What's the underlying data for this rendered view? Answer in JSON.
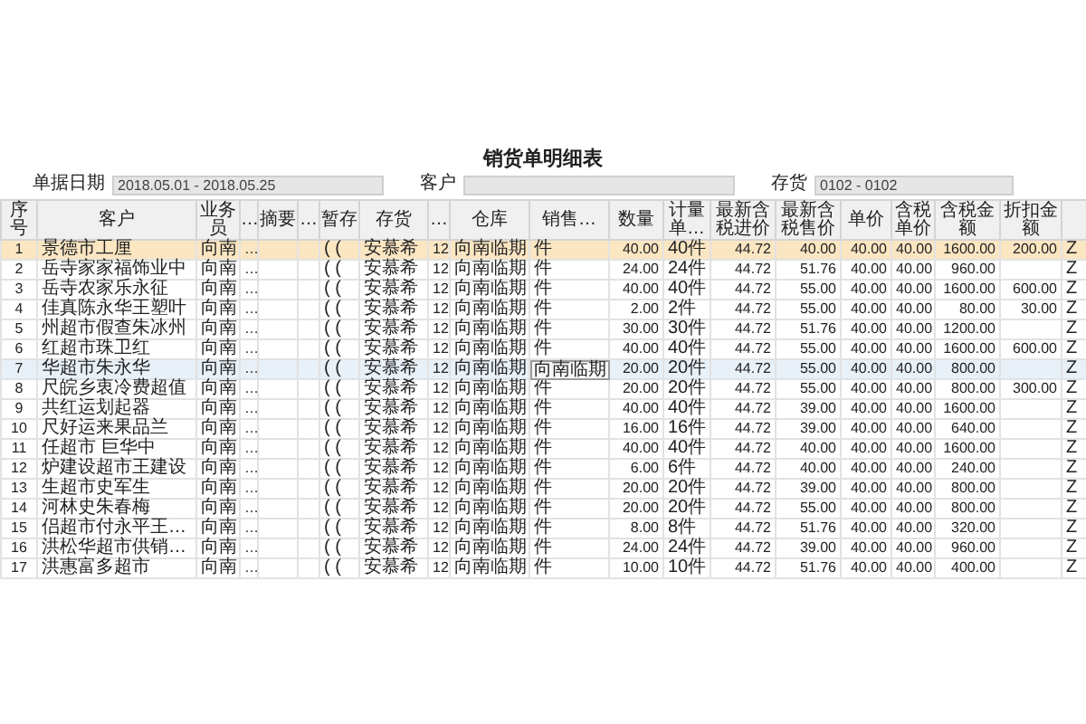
{
  "title": "销货单明细表",
  "filters": [
    {
      "label": "单据日期",
      "value": "2018.05.01 - 2018.05.25"
    },
    {
      "label": "客户"
    },
    {
      "label": "存货",
      "value": "0102 - 0102"
    }
  ],
  "table": {
    "columns": [
      "序号",
      "客户",
      "业务员",
      "…",
      "摘要",
      "…",
      "暂存",
      "存货",
      "…",
      "仓库",
      "销售…",
      "数量",
      "计量单…",
      "最新含税进价",
      "最新含税售价",
      "单价",
      "含税单价",
      "含税金额",
      "折扣金额"
    ],
    "rows": [
      {
        "selected": true,
        "hovered": false,
        "cells": [
          "1",
          "景德市工厘",
          "向南",
          "…",
          null,
          null,
          "( (",
          "安慕希",
          "12",
          "向南临期",
          "件",
          "40.00",
          "40件",
          "44.72",
          "40.00",
          "40.00",
          "40.00",
          "1600.00",
          "200.00",
          "Z"
        ]
      },
      {
        "selected": false,
        "hovered": false,
        "cells": [
          "2",
          "岳寺家家福饰业中",
          "向南",
          "…",
          null,
          null,
          "( (",
          "安慕希",
          "12",
          "向南临期",
          "件",
          "24.00",
          "24件",
          "44.72",
          "51.76",
          "40.00",
          "40.00",
          "960.00",
          null,
          "Z"
        ]
      },
      {
        "selected": false,
        "hovered": false,
        "cells": [
          "3",
          "岳寺农家乐永征",
          "向南",
          "…",
          null,
          null,
          "( (",
          "安慕希",
          "12",
          "向南临期",
          "件",
          "40.00",
          "40件",
          "44.72",
          "55.00",
          "40.00",
          "40.00",
          "1600.00",
          "600.00",
          "Z"
        ]
      },
      {
        "selected": false,
        "hovered": false,
        "cells": [
          "4",
          "佳真陈永华王塑叶",
          "向南",
          "…",
          null,
          null,
          "( (",
          "安慕希",
          "12",
          "向南临期",
          "件",
          "2.00",
          "2件",
          "44.72",
          "55.00",
          "40.00",
          "40.00",
          "80.00",
          "30.00",
          "Z"
        ]
      },
      {
        "selected": false,
        "hovered": false,
        "cells": [
          "5",
          "州超市假查朱冰州",
          "向南",
          "…",
          null,
          null,
          "( (",
          "安慕希",
          "12",
          "向南临期",
          "件",
          "30.00",
          "30件",
          "44.72",
          "51.76",
          "40.00",
          "40.00",
          "1200.00",
          null,
          "Z"
        ]
      },
      {
        "selected": false,
        "hovered": false,
        "cells": [
          "6",
          "红超市珠卫红",
          "向南",
          "…",
          null,
          null,
          "( (",
          "安慕希",
          "12",
          "向南临期",
          "件",
          "40.00",
          "40件",
          "44.72",
          "55.00",
          "40.00",
          "40.00",
          "1600.00",
          "600.00",
          "Z"
        ]
      },
      {
        "selected": false,
        "hovered": true,
        "tooltip": "向南临期",
        "cells": [
          "7",
          "华超市朱永华",
          "向南",
          "…",
          null,
          null,
          "( (",
          "安慕希",
          "12",
          "向南临期",
          null,
          "20.00",
          "20件",
          "44.72",
          "55.00",
          "40.00",
          "40.00",
          "800.00",
          null,
          "Z"
        ]
      },
      {
        "selected": false,
        "hovered": false,
        "cells": [
          "8",
          "尺皖乡衷冷费超值",
          "向南",
          "…",
          null,
          null,
          "( (",
          "安慕希",
          "12",
          "向南临期",
          "件",
          "20.00",
          "20件",
          "44.72",
          "55.00",
          "40.00",
          "40.00",
          "800.00",
          "300.00",
          "Z"
        ]
      },
      {
        "selected": false,
        "hovered": false,
        "cells": [
          "9",
          "共红运划起器",
          "向南",
          "…",
          null,
          null,
          "( (",
          "安慕希",
          "12",
          "向南临期",
          "件",
          "40.00",
          "40件",
          "44.72",
          "39.00",
          "40.00",
          "40.00",
          "1600.00",
          null,
          "Z"
        ]
      },
      {
        "selected": false,
        "hovered": false,
        "cells": [
          "10",
          "尺好运来果品兰",
          "向南",
          "…",
          null,
          null,
          "( (",
          "安慕希",
          "12",
          "向南临期",
          "件",
          "16.00",
          "16件",
          "44.72",
          "39.00",
          "40.00",
          "40.00",
          "640.00",
          null,
          "Z"
        ]
      },
      {
        "selected": false,
        "hovered": false,
        "cells": [
          "11",
          "任超市 巨华中",
          "向南",
          "…",
          null,
          null,
          "( (",
          "安慕希",
          "12",
          "向南临期",
          "件",
          "40.00",
          "40件",
          "44.72",
          "40.00",
          "40.00",
          "40.00",
          "1600.00",
          null,
          "Z"
        ]
      },
      {
        "selected": false,
        "hovered": false,
        "cells": [
          "12",
          "炉建设超市王建设",
          "向南",
          "…",
          null,
          null,
          "( (",
          "安慕希",
          "12",
          "向南临期",
          "件",
          "6.00",
          "6件",
          "44.72",
          "40.00",
          "40.00",
          "40.00",
          "240.00",
          null,
          "Z"
        ]
      },
      {
        "selected": false,
        "hovered": false,
        "cells": [
          "13",
          "生超市史军生",
          "向南",
          "…",
          null,
          null,
          "( (",
          "安慕希",
          "12",
          "向南临期",
          "件",
          "20.00",
          "20件",
          "44.72",
          "39.00",
          "40.00",
          "40.00",
          "800.00",
          null,
          "Z"
        ]
      },
      {
        "selected": false,
        "hovered": false,
        "cells": [
          "14",
          "河林史朱春梅",
          "向南",
          "…",
          null,
          null,
          "( (",
          "安慕希",
          "12",
          "向南临期",
          "件",
          "20.00",
          "20件",
          "44.72",
          "55.00",
          "40.00",
          "40.00",
          "800.00",
          null,
          "Z"
        ]
      },
      {
        "selected": false,
        "hovered": false,
        "cells": [
          "15",
          "侣超市付永平王…",
          "向南",
          "…",
          null,
          null,
          "( (",
          "安慕希",
          "12",
          "向南临期",
          "件",
          "8.00",
          "8件",
          "44.72",
          "51.76",
          "40.00",
          "40.00",
          "320.00",
          null,
          "Z"
        ]
      },
      {
        "selected": false,
        "hovered": false,
        "cells": [
          "16",
          "洪松华超市供销…",
          "向南",
          "…",
          null,
          null,
          "( (",
          "安慕希",
          "12",
          "向南临期",
          "件",
          "24.00",
          "24件",
          "44.72",
          "39.00",
          "40.00",
          "40.00",
          "960.00",
          null,
          "Z"
        ]
      },
      {
        "selected": false,
        "hovered": false,
        "cells": [
          "17",
          "洪惠富多超市",
          "向南",
          "…",
          null,
          null,
          "( (",
          "安慕希",
          "12",
          "向南临期",
          "件",
          "10.00",
          "10件",
          "44.72",
          "51.76",
          "40.00",
          "40.00",
          "400.00",
          null,
          "Z"
        ]
      }
    ]
  }
}
